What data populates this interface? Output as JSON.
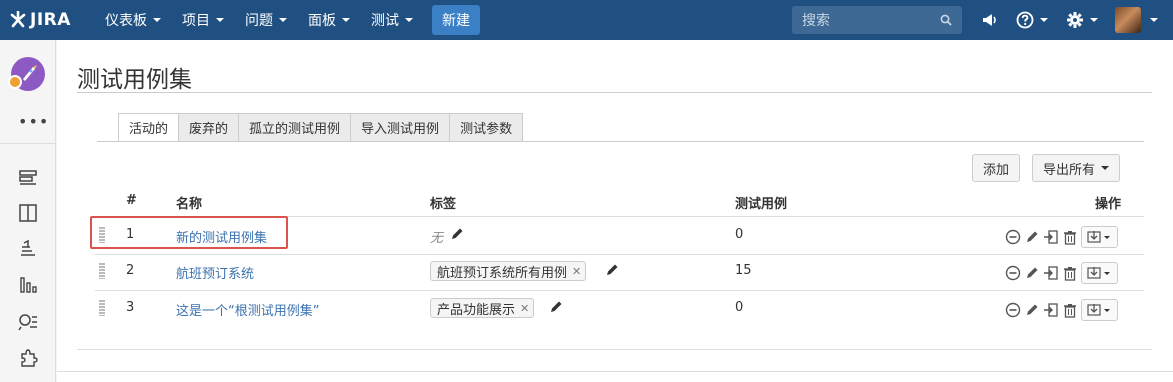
{
  "nav": {
    "logo": "JIRA",
    "menus": [
      "仪表板",
      "项目",
      "问题",
      "面板",
      "测试"
    ],
    "create": "新建",
    "search_placeholder": "搜索"
  },
  "page": {
    "title": "测试用例集",
    "tabs": [
      "活动的",
      "废弃的",
      "孤立的测试用例",
      "导入测试用例",
      "测试参数"
    ],
    "add_button": "添加",
    "export_button": "导出所有"
  },
  "table": {
    "headers": {
      "num": "#",
      "name": "名称",
      "labels": "标签",
      "cases": "测试用例",
      "actions": "操作"
    },
    "rows": [
      {
        "num": "1",
        "name": "新的测试用例集",
        "label": "",
        "none_label": "无",
        "cases": "0"
      },
      {
        "num": "2",
        "name": "航班预订系统",
        "label": "航班预订系统所有用例",
        "none_label": "",
        "cases": "15"
      },
      {
        "num": "3",
        "name": "这是一个“根测试用例集”",
        "label": "产品功能展示",
        "none_label": "",
        "cases": "0"
      }
    ]
  },
  "colors": {
    "topbar": "#205081",
    "link": "#3b73af",
    "highlight": "#d9534f"
  }
}
